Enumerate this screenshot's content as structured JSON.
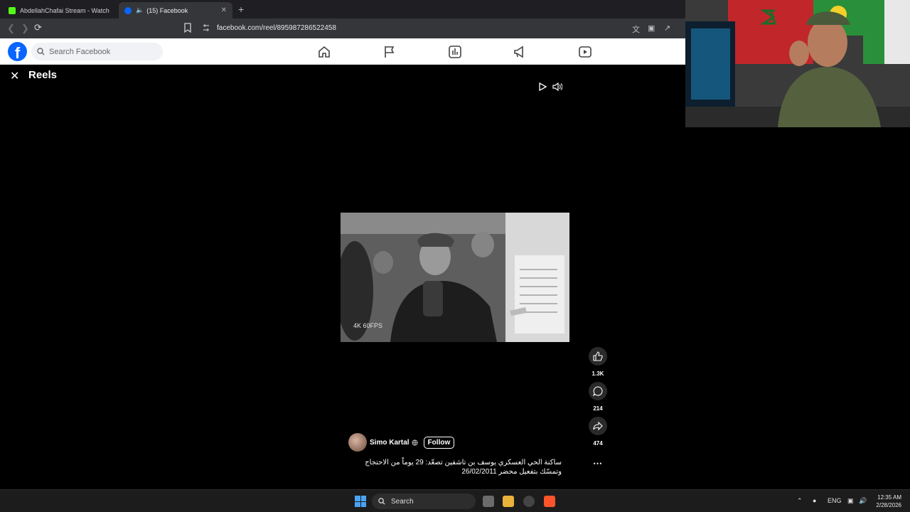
{
  "browser": {
    "tabs": [
      {
        "title": "AbdellahChafai Stream - Watch Live",
        "icon": "kick-icon",
        "active": false
      },
      {
        "title": "(15) Facebook",
        "icon": "facebook-icon",
        "active": true
      }
    ],
    "new_tab_label": "+",
    "url": "facebook.com/reel/895987286522458"
  },
  "facebook": {
    "logo_letter": "f",
    "search_placeholder": "Search Facebook",
    "nav_icons": [
      "home-icon",
      "flag-icon",
      "chart-icon",
      "megaphone-icon",
      "video-icon"
    ]
  },
  "reels": {
    "title": "Reels",
    "video_watermark": "4K 60FPS",
    "actions": {
      "likes": "1.3K",
      "comments": "214",
      "shares": "474"
    },
    "author": "Simo Kartal",
    "follow_label": "Follow",
    "caption_line1": "ساكنة الحي العسكري يوسف بن تاشفين تصعّد: 29 يوماً من الاحتجاج",
    "caption_line2": "وتمسّك بتفعيل محضر 26/02/2011"
  },
  "taskbar": {
    "search_label": "Search",
    "language": "ENG",
    "time": "12:35 AM",
    "date": "2/28/2026"
  },
  "colors": {
    "facebook_blue": "#0866ff",
    "browser_bg": "#35363a",
    "taskbar_bg": "#1c1c1c"
  }
}
